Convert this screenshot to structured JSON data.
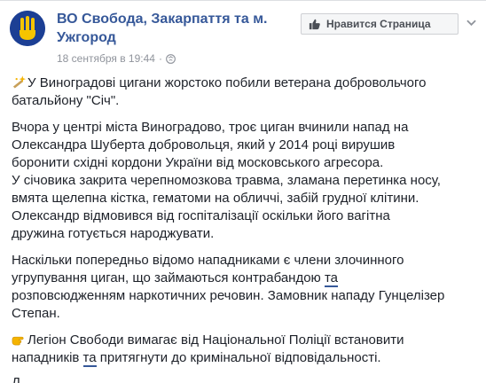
{
  "page": {
    "name": "ВО Свобода, Закарпаття та м. Ужгород",
    "date": "18 сентября в 19:44",
    "separator": "·",
    "privacy_icon": "globe-icon"
  },
  "header": {
    "like_button_label": "Нравится Страница",
    "like_icon": "thumbs-up-icon",
    "menu_icon": "chevron-down-icon"
  },
  "post": {
    "p1": [
      "У Виноградові цигани жорстоко побили ветерана добровольчого",
      "батальйону \"Січ\"."
    ],
    "p2": [
      "Вчора у центрі міста Виноградово, троє циган вчинили напад на",
      "Олександра Шуберта добровольця, який у 2014 році вирушив",
      "боронити східні кордони України від московського агресора.",
      "У січовика закрита черепномозкова травма, зламана перетинка носу,",
      "вмята щелепна кістка, гематоми на обличчі, забій грудної клітини.",
      "Олександр відмовився від госпіталізації оскільки його вагітна",
      "дружина готується народжувати."
    ],
    "p3": {
      "line1": "Наскільки попередньо відомо нападниками є члени злочинного",
      "line2_before": "угрупування циган, що займаються контрабандою ",
      "line2_link": "та",
      "line3": "розповсюдженням наркотичних речовин. Замовник нападу Гунцелізер",
      "line4": "Степан."
    },
    "p4": {
      "line1": "Легіон Свободи вимагає від Національної Поліції встановити",
      "line2_before": "нападників ",
      "line2_link": "та",
      "line2_after": " притягнути до кримінальної відповідальності."
    },
    "cut_text": "Д"
  },
  "colors": {
    "link": "#365899",
    "text": "#1d2129",
    "meta": "#90949c",
    "avatar_bg": "#1c3f94",
    "avatar_symbol": "#f6c400"
  }
}
